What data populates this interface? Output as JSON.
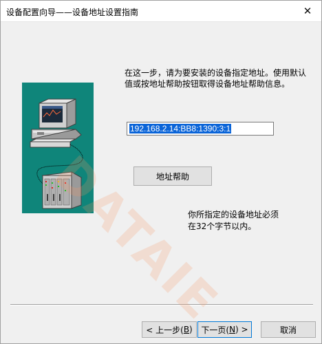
{
  "window": {
    "title": "设备配置向导——设备地址设置指南",
    "close_glyph": "✕"
  },
  "intro_text": "在这一步，请为要安装的设备指定地址。使用默认值或按地址帮助按钮取得设备地址帮助信息。",
  "address_input": {
    "value": "192.168.2.14:BB8:1390:3:1"
  },
  "help_button": {
    "label": "地址帮助"
  },
  "note_line1": "你所指定的设备地址必须",
  "note_line2": "在32个字节以内。",
  "buttons": {
    "back_pre": "< 上一步(",
    "back_key": "B",
    "back_post": ")",
    "next_pre": "下一页(",
    "next_key": "N",
    "next_post": ") >",
    "cancel": "取消"
  },
  "watermark": "DATAIE",
  "colors": {
    "illustration_bg": "#0f857a",
    "selection": "#0a64d8",
    "default_border": "#0078d7"
  },
  "icons": [
    "close-icon",
    "computer-icon",
    "device-rack-icon"
  ]
}
